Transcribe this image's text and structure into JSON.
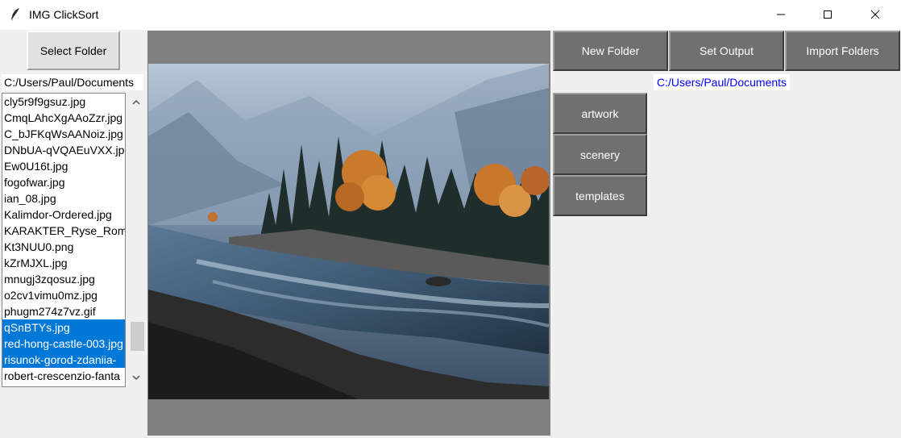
{
  "window": {
    "title": "IMG ClickSort",
    "controls": [
      "minimize",
      "maximize",
      "close"
    ]
  },
  "left_panel": {
    "select_folder_label": "Select Folder",
    "current_path": "C:/Users/Paul/Documents",
    "files": [
      {
        "name": "cly5r9f9gsuz.jpg",
        "selected": false
      },
      {
        "name": "CmqLAhcXgAAoZzr.jpg",
        "selected": false
      },
      {
        "name": "C_bJFKqWsAANoiz.jpg",
        "selected": false
      },
      {
        "name": "DNbUA-qVQAEuVXX.jpg",
        "selected": false
      },
      {
        "name": "Ew0U16t.jpg",
        "selected": false
      },
      {
        "name": "fogofwar.jpg",
        "selected": false
      },
      {
        "name": "ian_08.jpg",
        "selected": false
      },
      {
        "name": "Kalimdor-Ordered.jpg",
        "selected": false
      },
      {
        "name": "KARAKTER_Ryse_Rome",
        "selected": false
      },
      {
        "name": "Kt3NUU0.png",
        "selected": false
      },
      {
        "name": "kZrMJXL.jpg",
        "selected": false
      },
      {
        "name": "mnugj3zqosuz.jpg",
        "selected": false
      },
      {
        "name": "o2cv1vimu0mz.jpg",
        "selected": false
      },
      {
        "name": "phugm274z7vz.gif",
        "selected": false
      },
      {
        "name": "qSnBTYs.jpg",
        "selected": true
      },
      {
        "name": "red-hong-castle-003.jpg",
        "selected": true
      },
      {
        "name": "risunok-gorod-zdaniia-",
        "selected": true
      },
      {
        "name": "robert-crescenzio-fanta",
        "selected": false
      }
    ]
  },
  "toolbar": {
    "new_folder_label": "New Folder",
    "set_output_label": "Set Output",
    "import_folders_label": "Import Folders"
  },
  "output": {
    "path": "C:/Users/Paul/Documents"
  },
  "folders": [
    {
      "label": "artwork"
    },
    {
      "label": "scenery"
    },
    {
      "label": "templates"
    }
  ],
  "preview": {
    "description_icon": "landscape-photo"
  },
  "colors": {
    "button_gray": "#707070",
    "selection_blue": "#0078d7",
    "path_text_blue": "#0000ff",
    "canvas_gray": "#808080"
  }
}
